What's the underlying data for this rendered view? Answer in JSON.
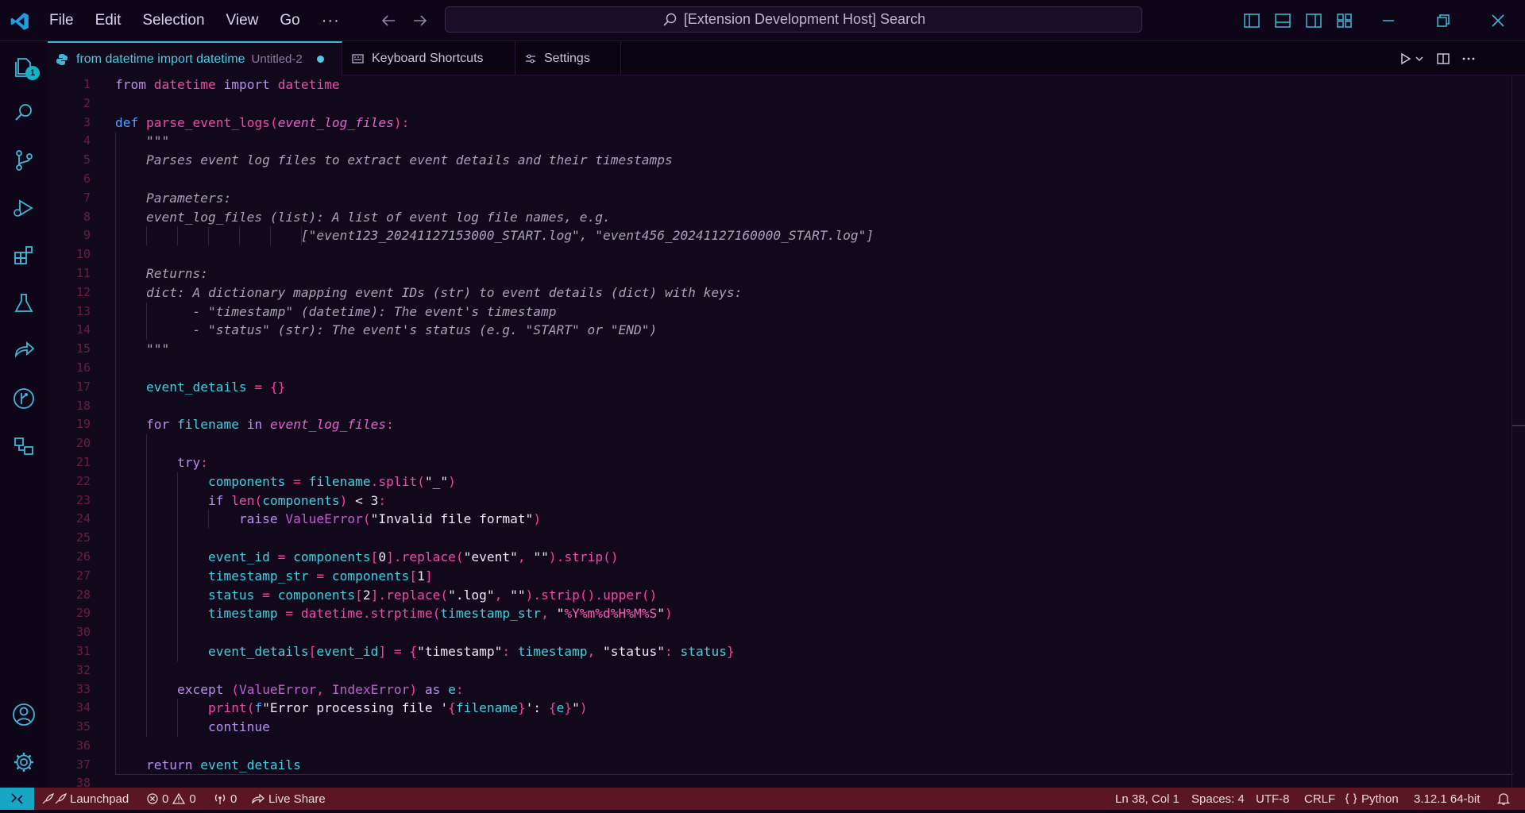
{
  "menu": [
    "File",
    "Edit",
    "Selection",
    "View",
    "Go"
  ],
  "menu_more": "···",
  "search": {
    "text": "[Extension Development Host] Search"
  },
  "explorer_badge": "1",
  "tabs": [
    {
      "label": "from datetime import datetime",
      "sub": "Untitled-2",
      "modified": true,
      "icon": "python-icon"
    },
    {
      "label": "Keyboard Shortcuts",
      "icon": "keyboard-icon"
    },
    {
      "label": "Settings",
      "icon": "settings-tab-icon"
    }
  ],
  "line_numbers": [
    "1",
    "2",
    "3",
    "4",
    "5",
    "6",
    "7",
    "8",
    "9",
    "10",
    "11",
    "12",
    "13",
    "14",
    "15",
    "16",
    "17",
    "18",
    "19",
    "20",
    "21",
    "22",
    "23",
    "24",
    "25",
    "26",
    "27",
    "28",
    "29",
    "30",
    "31",
    "32",
    "33",
    "34",
    "35",
    "36",
    "37",
    "38"
  ],
  "code": {
    "l1": [
      "from",
      " ",
      "datetime",
      " ",
      "import",
      " ",
      "datetime"
    ],
    "l3": [
      "def",
      " ",
      "parse_event_logs",
      "(",
      "event_log_files",
      "):"
    ],
    "l4": "\"\"\"",
    "l5": "Parses event log files to extract event details and their timestamps",
    "l7": "Parameters:",
    "l8": "event_log_files (list): A list of event log file names, e.g.",
    "l9": "[\"event123_20241127153000_START.log\", \"event456_20241127160000_START.log\"]",
    "l11": "Returns:",
    "l12": "dict: A dictionary mapping event IDs (str) to event details (dict) with keys:",
    "l13": "- \"timestamp\" (datetime): The event's timestamp",
    "l14": "- \"status\" (str): The event's status (e.g. \"START\" or \"END\")",
    "l15": "\"\"\"",
    "l17": [
      "event_details",
      " = ",
      "{}"
    ],
    "l19": [
      "for",
      " filename ",
      "in",
      " ",
      "event_log_files",
      ":"
    ],
    "l21": [
      "try",
      ":"
    ],
    "l22": [
      "components",
      " = ",
      "filename",
      ".",
      "split",
      "(",
      "\"_\"",
      ")"
    ],
    "l23": [
      "if",
      " ",
      "len",
      "(",
      "components",
      ")",
      " < 3",
      ":"
    ],
    "l24": [
      "raise",
      " ",
      "ValueError",
      "(",
      "\"Invalid file format\"",
      ")"
    ],
    "l26": [
      "event_id",
      " = ",
      "components",
      "[",
      "0",
      "].",
      "replace",
      "(",
      "\"event\"",
      ", ",
      "\"\"",
      ").",
      "strip",
      "()"
    ],
    "l27": [
      "timestamp_str",
      " = ",
      "components",
      "[",
      "1",
      "]"
    ],
    "l28": [
      "status",
      " = ",
      "components",
      "[",
      "2",
      "].",
      "replace",
      "(",
      "\".log\"",
      ", ",
      "\"\"",
      ").",
      "strip",
      "().",
      "upper",
      "()"
    ],
    "l29": [
      "timestamp",
      " = ",
      "datetime",
      ".",
      "strptime",
      "(",
      "timestamp_str",
      ", ",
      "\"",
      "%Y%m%d%H%M%S",
      "\"",
      ")"
    ],
    "l31": [
      "event_details",
      "[",
      "event_id",
      "] = {",
      "\"timestamp\"",
      ": ",
      "timestamp",
      ", ",
      "\"status\"",
      ": ",
      "status",
      "}"
    ],
    "l33": [
      "except",
      " (",
      "ValueError",
      ", ",
      "IndexError",
      ") ",
      "as",
      " ",
      "e",
      ":"
    ],
    "l34": [
      "print",
      "(",
      "f",
      "\"Error processing file '",
      "{",
      "filename",
      "}",
      "': ",
      "{",
      "e",
      "}",
      "\"",
      ")"
    ],
    "l35": "continue",
    "l37": [
      "return",
      " ",
      "event_details"
    ]
  },
  "status": {
    "launchpad": "Launchpad",
    "errors": "0",
    "warnings": "0",
    "ports": "0",
    "liveshare": "Live Share",
    "position": "Ln 38, Col 1",
    "spaces": "Spaces: 4",
    "encoding": "UTF-8",
    "eol": "CRLF",
    "language": "Python",
    "interpreter": "3.12.1 64-bit"
  },
  "colors": {
    "accent": "#3fb7d9",
    "statusbar": "#5a1622",
    "background": "#12081c"
  }
}
